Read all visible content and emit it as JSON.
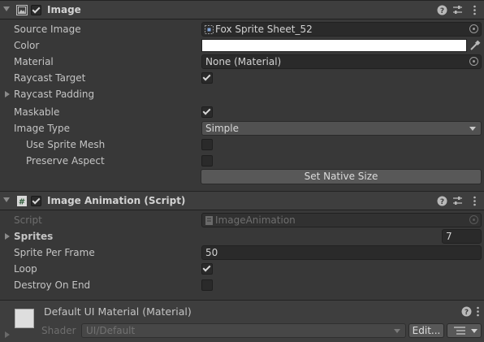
{
  "image_component": {
    "title": "Image",
    "enabled": true,
    "icon": "image-icon",
    "fields": {
      "source_image": {
        "label": "Source Image",
        "value": "Fox Sprite Sheet_52"
      },
      "color": {
        "label": "Color",
        "value": "#ffffff"
      },
      "material": {
        "label": "Material",
        "value": "None (Material)"
      },
      "raycast_target": {
        "label": "Raycast Target",
        "checked": true
      },
      "raycast_padding": {
        "label": "Raycast Padding"
      },
      "maskable": {
        "label": "Maskable",
        "checked": true
      },
      "image_type": {
        "label": "Image Type",
        "value": "Simple"
      },
      "use_sprite_mesh": {
        "label": "Use Sprite Mesh",
        "checked": false
      },
      "preserve_aspect": {
        "label": "Preserve Aspect",
        "checked": false
      }
    },
    "set_native_size_label": "Set Native Size"
  },
  "animation_component": {
    "title": "Image Animation (Script)",
    "enabled": true,
    "icon": "script-icon",
    "fields": {
      "script": {
        "label": "Script",
        "value": "ImageAnimation"
      },
      "sprites": {
        "label": "Sprites",
        "count": "7"
      },
      "sprite_per_frame": {
        "label": "Sprite Per Frame",
        "value": "50"
      },
      "loop": {
        "label": "Loop",
        "checked": true
      },
      "destroy_on_end": {
        "label": "Destroy On End",
        "checked": false
      }
    }
  },
  "material_preview": {
    "title": "Default UI Material (Material)",
    "shader_label": "Shader",
    "shader_value": "UI/Default",
    "edit_label": "Edit..."
  },
  "colors": {
    "background": "#383838",
    "header": "#3e3e3e",
    "field": "#2a2a2a",
    "button": "#585858",
    "text": "#c4c4c4",
    "disabled_text": "#6e6e6e"
  }
}
